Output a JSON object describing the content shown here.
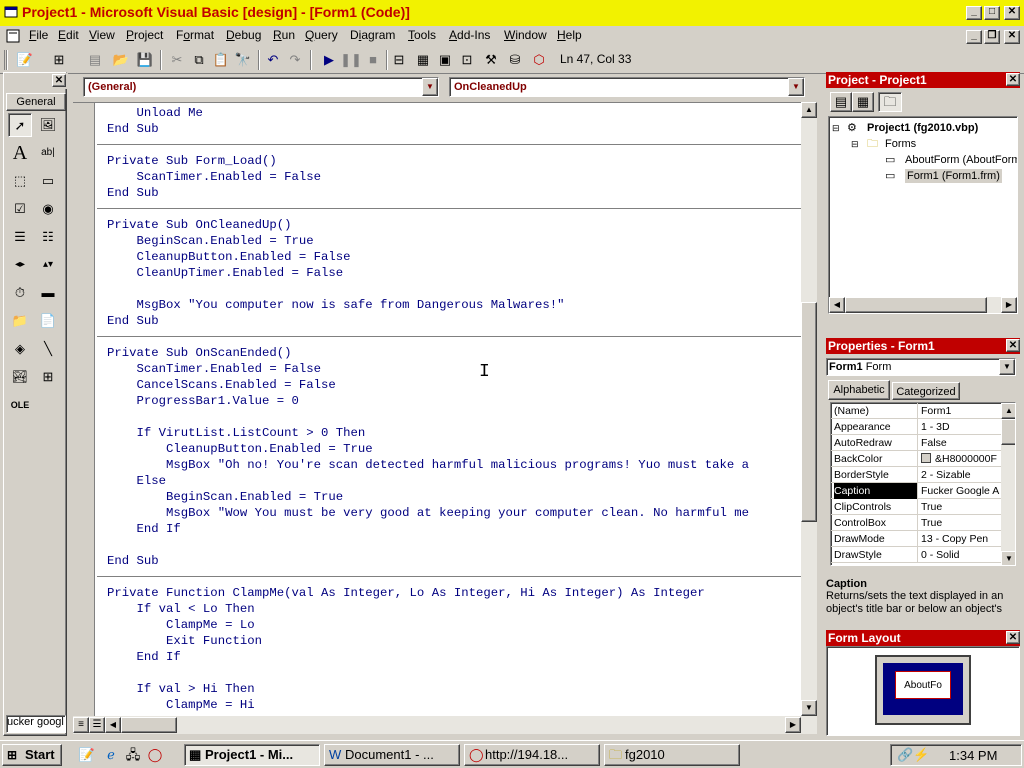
{
  "titlebar": {
    "title": "Project1 - Microsoft Visual Basic [design] - [Form1 (Code)]"
  },
  "menu": [
    {
      "text": "File",
      "key": "F"
    },
    {
      "text": "Edit",
      "key": "E"
    },
    {
      "text": "View",
      "key": "V"
    },
    {
      "text": "Project",
      "key": "P"
    },
    {
      "text": "Format",
      "key": "o"
    },
    {
      "text": "Debug",
      "key": "D"
    },
    {
      "text": "Run",
      "key": "R"
    },
    {
      "text": "Query",
      "key": "Q"
    },
    {
      "text": "Diagram",
      "key": "i"
    },
    {
      "text": "Tools",
      "key": "T"
    },
    {
      "text": "Add-Ins",
      "key": "A"
    },
    {
      "text": "Window",
      "key": "W"
    },
    {
      "text": "Help",
      "key": "H"
    }
  ],
  "toolbar": {
    "position": "Ln 47, Col 33"
  },
  "toolbox": {
    "tab": "General",
    "bottom_text": "ucker googl"
  },
  "code": {
    "object_combo": "(General)",
    "proc_combo": "OnCleanedUp",
    "lines": [
      "    Unload Me",
      "End Sub",
      "",
      "Private Sub Form_Load()",
      "    ScanTimer.Enabled = False",
      "End Sub",
      "",
      "Private Sub OnCleanedUp()",
      "    BeginScan.Enabled = True",
      "    CleanupButton.Enabled = False",
      "    CleanUpTimer.Enabled = False",
      "",
      "    MsgBox \"You computer now is safe from Dangerous Malwares!\"",
      "End Sub",
      "",
      "Private Sub OnScanEnded()",
      "    ScanTimer.Enabled = False",
      "    CancelScans.Enabled = False",
      "    ProgressBar1.Value = 0",
      "",
      "    If VirutList.ListCount > 0 Then",
      "        CleanupButton.Enabled = True",
      "        MsgBox \"Oh no! You're scan detected harmful malicious programs! Yuo must take a",
      "    Else",
      "        BeginScan.Enabled = True",
      "        MsgBox \"Wow You must be very good at keeping your computer clean. No harmful me",
      "    End If",
      "",
      "End Sub",
      "",
      "Private Function ClampMe(val As Integer, Lo As Integer, Hi As Integer) As Integer",
      "    If val < Lo Then",
      "        ClampMe = Lo",
      "        Exit Function",
      "    End If",
      "",
      "    If val > Hi Then",
      "        ClampMe = Hi"
    ]
  },
  "project": {
    "title": "Project - Project1",
    "root": "Project1 (fg2010.vbp)",
    "folder": "Forms",
    "items": [
      "AboutForm (AboutForm",
      "Form1 (Form1.frm)"
    ]
  },
  "properties": {
    "title": "Properties - Form1",
    "object_name": "Form1",
    "object_type": "Form",
    "tabs": [
      "Alphabetic",
      "Categorized"
    ],
    "rows": [
      {
        "name": "(Name)",
        "value": "Form1"
      },
      {
        "name": "Appearance",
        "value": "1 - 3D"
      },
      {
        "name": "AutoRedraw",
        "value": "False"
      },
      {
        "name": "BackColor",
        "value": "&H8000000F"
      },
      {
        "name": "BorderStyle",
        "value": "2 - Sizable"
      },
      {
        "name": "Caption",
        "value": "Fucker Google A"
      },
      {
        "name": "ClipControls",
        "value": "True"
      },
      {
        "name": "ControlBox",
        "value": "True"
      },
      {
        "name": "DrawMode",
        "value": "13 - Copy Pen"
      },
      {
        "name": "DrawStyle",
        "value": "0 - Solid"
      }
    ],
    "desc_title": "Caption",
    "desc_text": "Returns/sets the text displayed in an object's title bar or below an object's"
  },
  "layout": {
    "title": "Form Layout",
    "form_label": "AboutFo"
  },
  "taskbar": {
    "start": "Start",
    "tasks": [
      "Project1 - Mi...",
      "Document1 - ...",
      "http://194.18...",
      "fg2010"
    ],
    "clock": "1:34 PM"
  },
  "colors": {
    "title_bg": "#f2f200",
    "title_fg": "#c00000",
    "panel_title": "#c00000",
    "code_text": "#000080"
  }
}
